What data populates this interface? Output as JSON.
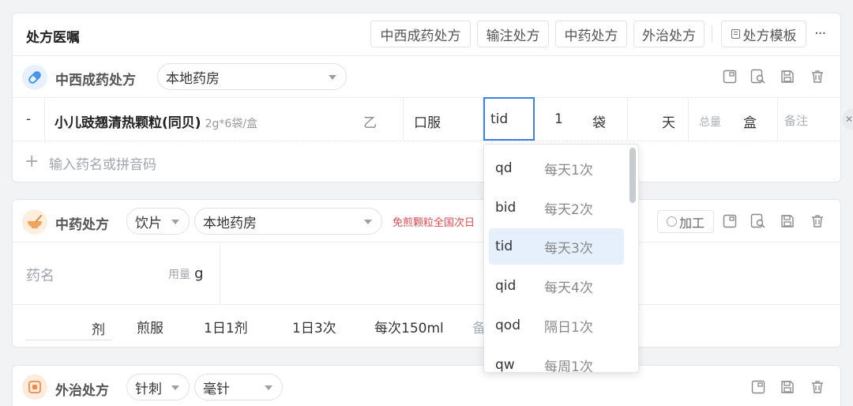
{
  "header": {
    "title": "处方医嘱",
    "tabs": [
      "中西成药处方",
      "输注处方",
      "中药处方",
      "外治处方"
    ],
    "template_label": "处方模板",
    "more_label": "···"
  },
  "western": {
    "title": "中西成药处方",
    "pharmacy": "本地药房",
    "drug": {
      "prefix": "-",
      "name": "小儿豉翘清热颗粒(同贝)",
      "spec": "2g*6袋/盒",
      "grade": "乙",
      "route": "口服",
      "freq": "tid",
      "dose": "1",
      "unit": "袋",
      "days_unit": "天",
      "total_label": "总量",
      "total_unit": "盒",
      "note_placeholder": "备注"
    },
    "add_placeholder": "输入药名或拼音码"
  },
  "chinese": {
    "title": "中药处方",
    "type": "饮片",
    "pharmacy": "本地药房",
    "notice": "免煎颗粒全国次日",
    "process_label": "加工",
    "drug_placeholder": "药名",
    "dose_label": "用量",
    "dose_unit": "g",
    "doses_unit": "剂",
    "usage": "煎服",
    "daily": "1日1剂",
    "times": "1日3次",
    "amount": "每次150ml",
    "note_partial": "备"
  },
  "external": {
    "title": "外治处方",
    "type": "针刺",
    "subtype": "毫针"
  },
  "freq_dropdown": [
    {
      "code": "qd",
      "desc": "每天1次"
    },
    {
      "code": "bid",
      "desc": "每天2次"
    },
    {
      "code": "tid",
      "desc": "每天3次"
    },
    {
      "code": "qid",
      "desc": "每天4次"
    },
    {
      "code": "qod",
      "desc": "隔日1次"
    },
    {
      "code": "qw",
      "desc": "每周1次"
    }
  ],
  "colors": {
    "accent": "#3b82e6",
    "notice_red": "#e5484d",
    "pill_blue": "#3b8df0",
    "mortar_orange": "#f0a460",
    "external_orange": "#ef8a4a"
  }
}
